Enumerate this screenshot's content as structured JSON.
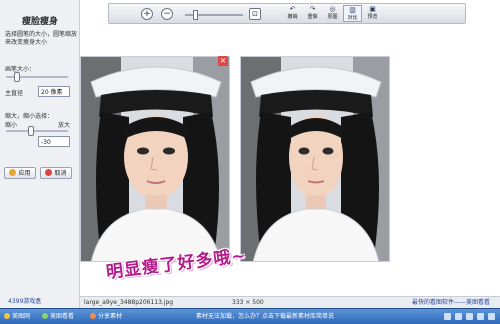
{
  "sidebar": {
    "title": "瘦脸瘦身",
    "hint": "选择圆笔的大小，圆笔缩放来改变瘦身大小",
    "brush_size_label": "画笔大小：",
    "diameter_label": "主直径",
    "diameter_value": "20 像素",
    "scale_label": "缩大，缩小选择：",
    "scale_min_label": "缩小",
    "scale_max_label": "放大",
    "scale_value": "-30",
    "apply_label": "应用",
    "cancel_label": "取消",
    "bottom_text": "4399游戏盒"
  },
  "toolbar": {
    "zoom_in_icon": "zoom-in-icon",
    "zoom_out_icon": "zoom-out-icon",
    "fit_icon": "fit-icon",
    "undo": "撤销",
    "redo": "重做",
    "original": "原图",
    "compare": "对比",
    "preview": "预览"
  },
  "caption": "明显瘦了好多哦~",
  "status": {
    "filename": "large_a9ye_3488p206113.jpg",
    "dimensions": "333 × 500",
    "center": "素材无法加载，怎么办？点击下载最新素材库简单说",
    "right": "最快的看图软件——美图看看"
  },
  "taskbar": {
    "item1": "美图网",
    "item2": "美图看看",
    "item3": "分享素材"
  },
  "colors": {
    "caption": "#b31c8a",
    "taskbar": "#2f67b8",
    "close": "#e04848"
  }
}
